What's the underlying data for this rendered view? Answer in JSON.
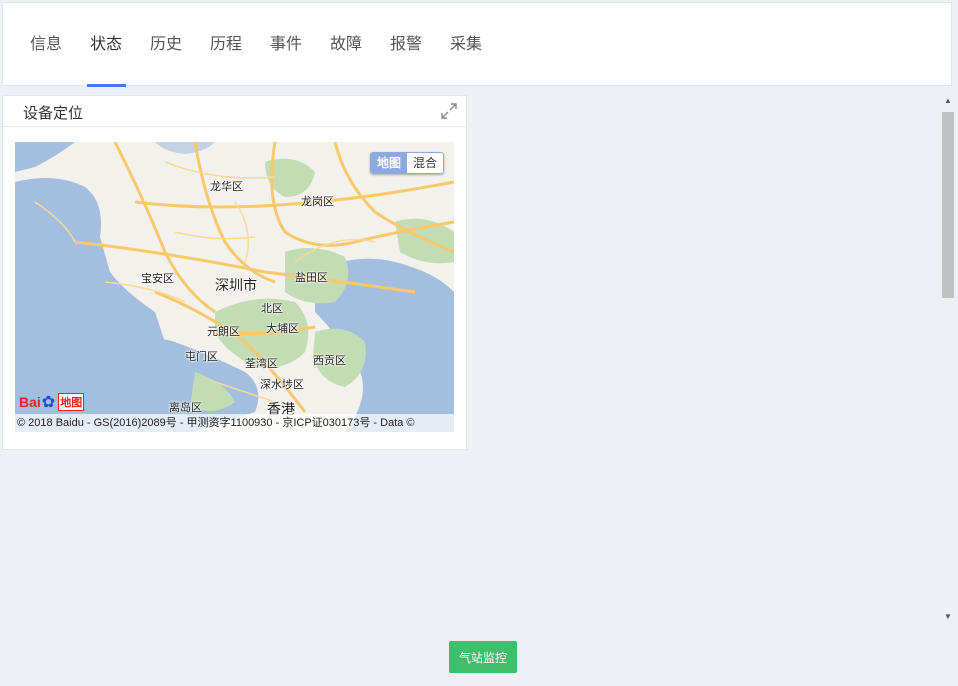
{
  "tabs": [
    {
      "label": "信息"
    },
    {
      "label": "状态"
    },
    {
      "label": "历史"
    },
    {
      "label": "历程"
    },
    {
      "label": "事件"
    },
    {
      "label": "故障"
    },
    {
      "label": "报警"
    },
    {
      "label": "采集"
    }
  ],
  "active_tab": "状态",
  "card": {
    "title": "设备定位",
    "expand_icon": "expand-icon"
  },
  "map": {
    "type_map": "地图",
    "type_hybrid": "混合",
    "labels": {
      "longhua": "龙华区",
      "longgang": "龙岗区",
      "baoan": "宝安区",
      "shenzhen": "深圳市",
      "yantian": "盐田区",
      "north": "北区",
      "yuanlang": "元朗区",
      "dabu": "大埔区",
      "tunmen": "屯门区",
      "quanwan": "荃湾区",
      "xigong": "西贡区",
      "shenshuibu": "深水埗区",
      "lidao": "离岛区",
      "hongkong": "香港"
    },
    "copyright": "© 2018 Baidu - GS(2016)2089号 - 甲测资字1100930 - 京ICP证030173号 - Data ©",
    "logo_text": "Bai",
    "logo_badge": "地图"
  },
  "button": {
    "label": "气站监控"
  },
  "colors": {
    "accent": "#3d7cf0",
    "button": "#3fbe6c",
    "water": "#a3bedf",
    "land": "#f3f1ec",
    "green": "#c2dcb4",
    "road": "#f8c86a"
  }
}
